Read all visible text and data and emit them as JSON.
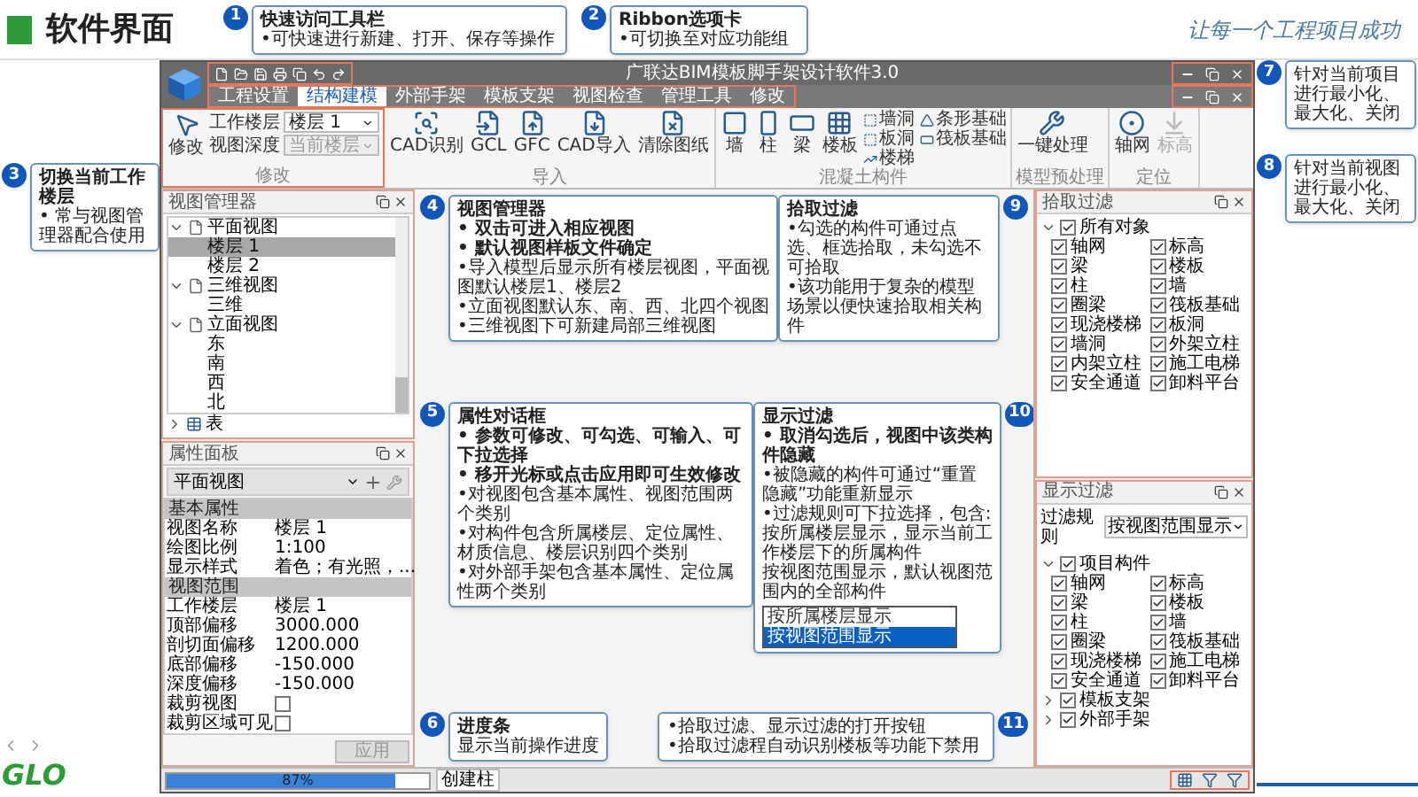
{
  "slide": {
    "title": "软件界面",
    "slogan": "让每一个工程项目成功",
    "logo": "GLO"
  },
  "callouts": [
    {
      "number": "1",
      "title": "快速访问工具栏",
      "lines": [
        {
          "text": "•可快速进行新建、打开、保存等操作",
          "bold": false
        }
      ]
    },
    {
      "number": "2",
      "title": "Ribbon选项卡",
      "lines": [
        {
          "text": "•可切换至对应功能组",
          "bold": false
        }
      ]
    },
    {
      "number": "3",
      "title": "切换当前工作楼层",
      "lines": [
        {
          "text": "• 常与视图管理器配合使用",
          "bold": false
        }
      ]
    },
    {
      "number": "4",
      "title": "视图管理器",
      "lines": [
        {
          "text": "• 双击可进入相应视图",
          "bold": true
        },
        {
          "text": "• 默认视图样板文件确定",
          "bold": true
        },
        {
          "text": "•导入模型后显示所有楼层视图，平面视图默认楼层1、楼层2",
          "bold": false
        },
        {
          "text": "•立面视图默认东、南、西、北四个视图",
          "bold": false
        },
        {
          "text": "•三维视图下可新建局部三维视图",
          "bold": false
        }
      ]
    },
    {
      "number": "5",
      "title": "属性对话框",
      "lines": [
        {
          "text": "• 参数可修改、可勾选、可输入、可下拉选择",
          "bold": true
        },
        {
          "text": "• 移开光标或点击应用即可生效修改",
          "bold": true
        },
        {
          "text": "•对视图包含基本属性、视图范围两个类别",
          "bold": false
        },
        {
          "text": "•对构件包含所属楼层、定位属性、材质信息、楼层识别四个类别",
          "bold": false
        },
        {
          "text": "•对外部手架包含基本属性、定位属性两个类别",
          "bold": false
        }
      ]
    },
    {
      "number": "6",
      "title": "进度条",
      "lines": [
        {
          "text": "显示当前操作进度",
          "bold": false
        }
      ]
    },
    {
      "number": "7",
      "lines": [
        {
          "text": "针对当前项目进行最小化、最大化、关闭",
          "bold": false
        }
      ]
    },
    {
      "number": "8",
      "lines": [
        {
          "text": "针对当前视图进行最小化、最大化、关闭",
          "bold": false
        }
      ]
    },
    {
      "number": "9",
      "title": "拾取过滤",
      "lines": [
        {
          "text": "•勾选的构件可通过点选、框选拾取，未勾选不可拾取",
          "bold": false
        },
        {
          "text": "•该功能用于复杂的模型场景以便快速拾取相关构件",
          "bold": false
        }
      ]
    },
    {
      "number": "10",
      "title": "显示过滤",
      "lines": [
        {
          "text": "• 取消勾选后，视图中该类构件隐藏",
          "bold": true
        },
        {
          "text": "•被隐藏的构件可通过“重置隐藏”功能重新显示",
          "bold": false
        },
        {
          "text": "•过滤规则可下拉选择，包含:",
          "bold": false
        },
        {
          "text": "按所属楼层显示，显示当前工作楼层下的所属构件",
          "bold": false
        },
        {
          "text": "按视图范围显示，默认视图范围内的全部构件",
          "bold": false
        }
      ],
      "options": [
        {
          "label": "按所属楼层显示",
          "selected": false
        },
        {
          "label": "按视图范围显示",
          "selected": true
        }
      ]
    },
    {
      "number": "11",
      "lines": [
        {
          "text": "•拾取过滤、显示过滤的打开按钮",
          "bold": false
        },
        {
          "text": "•拾取过滤程自动识别楼板等功能下禁用",
          "bold": false
        }
      ]
    }
  ],
  "window": {
    "title": "广联达BIM模板脚手架设计软件3.0"
  },
  "tabs": [
    {
      "label": "工程设置",
      "selected": false
    },
    {
      "label": "结构建模",
      "selected": true
    },
    {
      "label": "外部手架",
      "selected": false
    },
    {
      "label": "模板支架",
      "selected": false
    },
    {
      "label": "视图检查",
      "selected": false
    },
    {
      "label": "管理工具",
      "selected": false
    },
    {
      "label": "修改",
      "selected": false
    }
  ],
  "ribbon": {
    "groups": [
      {
        "label": "修改",
        "buttons": [
          {
            "label": "修改",
            "disabled": false
          }
        ],
        "fields": [
          {
            "label": "工作楼层",
            "value": "楼层 1",
            "disabled": false
          },
          {
            "label": "视图深度",
            "value": "当前楼层",
            "disabled": true
          }
        ]
      },
      {
        "label": "导入",
        "buttons": [
          {
            "label": "CAD识别",
            "disabled": false
          },
          {
            "label": "GCL",
            "disabled": false
          },
          {
            "label": "GFC",
            "disabled": false
          },
          {
            "label": "CAD导入",
            "disabled": false
          },
          {
            "label": "清除图纸",
            "disabled": false
          }
        ]
      },
      {
        "label": "混凝土构件",
        "buttons": [
          {
            "label": "墙",
            "disabled": false
          },
          {
            "label": "柱",
            "disabled": false
          },
          {
            "label": "梁",
            "disabled": false
          },
          {
            "label": "楼板",
            "disabled": false
          }
        ],
        "small_buttons": [
          {
            "label": "墙洞"
          },
          {
            "label": "板洞"
          },
          {
            "label": "楼梯"
          },
          {
            "label": "条形基础"
          },
          {
            "label": "筏板基础"
          }
        ]
      },
      {
        "label": "模型预处理",
        "buttons": [
          {
            "label": "一键处理",
            "disabled": false
          }
        ]
      },
      {
        "label": "定位",
        "buttons": [
          {
            "label": "轴网",
            "disabled": false
          },
          {
            "label": "标高",
            "disabled": true
          }
        ]
      }
    ]
  },
  "view_manager": {
    "title": "视图管理器",
    "tree": [
      {
        "label": "平面视图",
        "expanded": true,
        "children": [
          {
            "label": "楼层 1",
            "selected": true
          },
          {
            "label": "楼层 2",
            "selected": false
          }
        ]
      },
      {
        "label": "三维视图",
        "expanded": true,
        "children": [
          {
            "label": "三维",
            "selected": false
          }
        ]
      },
      {
        "label": "立面视图",
        "expanded": true,
        "children": [
          {
            "label": "东",
            "selected": false
          },
          {
            "label": "南",
            "selected": false
          },
          {
            "label": "西",
            "selected": false
          },
          {
            "label": "北",
            "selected": false
          }
        ]
      }
    ],
    "sheets": [
      {
        "label": "表",
        "expanded": false
      }
    ]
  },
  "properties": {
    "title": "属性面板",
    "type": "平面视图",
    "sections": [
      {
        "label": "基本属性",
        "rows": [
          {
            "kind": "text",
            "name": "视图名称",
            "value": "楼层 1"
          },
          {
            "kind": "text",
            "name": "绘图比例",
            "value": "1:100"
          },
          {
            "kind": "text",
            "name": "显示样式",
            "value": "着色；有光照，..."
          }
        ]
      },
      {
        "label": "视图范围",
        "rows": [
          {
            "kind": "text",
            "name": "工作楼层",
            "value": "楼层 1"
          },
          {
            "kind": "text",
            "name": "顶部偏移",
            "value": "3000.000"
          },
          {
            "kind": "text",
            "name": "剖切面偏移",
            "value": "1200.000"
          },
          {
            "kind": "text",
            "name": "底部偏移",
            "value": "-150.000"
          },
          {
            "kind": "text",
            "name": "深度偏移",
            "value": "-150.000"
          },
          {
            "kind": "checkbox",
            "name": "裁剪视图",
            "checked": false
          },
          {
            "kind": "checkbox",
            "name": "裁剪区域可见",
            "checked": false
          }
        ]
      }
    ],
    "apply": "应用"
  },
  "pick_filter": {
    "title": "拾取过滤",
    "tree": [
      {
        "label": "所有对象",
        "checked": true,
        "expanded": true,
        "children": [
          {
            "label": "轴网",
            "checked": true
          },
          {
            "label": "标高",
            "checked": true
          },
          {
            "label": "梁",
            "checked": true
          },
          {
            "label": "楼板",
            "checked": true
          },
          {
            "label": "柱",
            "checked": true
          },
          {
            "label": "墙",
            "checked": true
          },
          {
            "label": "圈梁",
            "checked": true
          },
          {
            "label": "筏板基础",
            "checked": true
          },
          {
            "label": "现浇楼梯",
            "checked": true
          },
          {
            "label": "板洞",
            "checked": true
          },
          {
            "label": "墙洞",
            "checked": true
          },
          {
            "label": "外架立柱",
            "checked": true
          },
          {
            "label": "内架立柱",
            "checked": true
          },
          {
            "label": "施工电梯",
            "checked": true
          },
          {
            "label": "安全通道",
            "checked": true
          },
          {
            "label": "卸料平台",
            "checked": true
          }
        ]
      }
    ]
  },
  "display_filter": {
    "title": "显示过滤",
    "rule_label": "过滤规则",
    "rule_value": "按视图范围显示",
    "tree": [
      {
        "label": "项目构件",
        "checked": true,
        "expanded": true,
        "children": [
          {
            "label": "轴网",
            "checked": true
          },
          {
            "label": "标高",
            "checked": true
          },
          {
            "label": "梁",
            "checked": true
          },
          {
            "label": "楼板",
            "checked": true
          },
          {
            "label": "柱",
            "checked": true
          },
          {
            "label": "墙",
            "checked": true
          },
          {
            "label": "圈梁",
            "checked": true
          },
          {
            "label": "筏板基础",
            "checked": true
          },
          {
            "label": "现浇楼梯",
            "checked": true
          },
          {
            "label": "施工电梯",
            "checked": true
          },
          {
            "label": "安全通道",
            "checked": true
          },
          {
            "label": "卸料平台",
            "checked": true
          }
        ]
      },
      {
        "label": "模板支架",
        "checked": true,
        "expanded": false
      },
      {
        "label": "外部手架",
        "checked": true,
        "expanded": false
      }
    ]
  },
  "status_bar": {
    "progress": {
      "level": 0.87,
      "reading": "87%"
    },
    "message": "创建柱"
  }
}
